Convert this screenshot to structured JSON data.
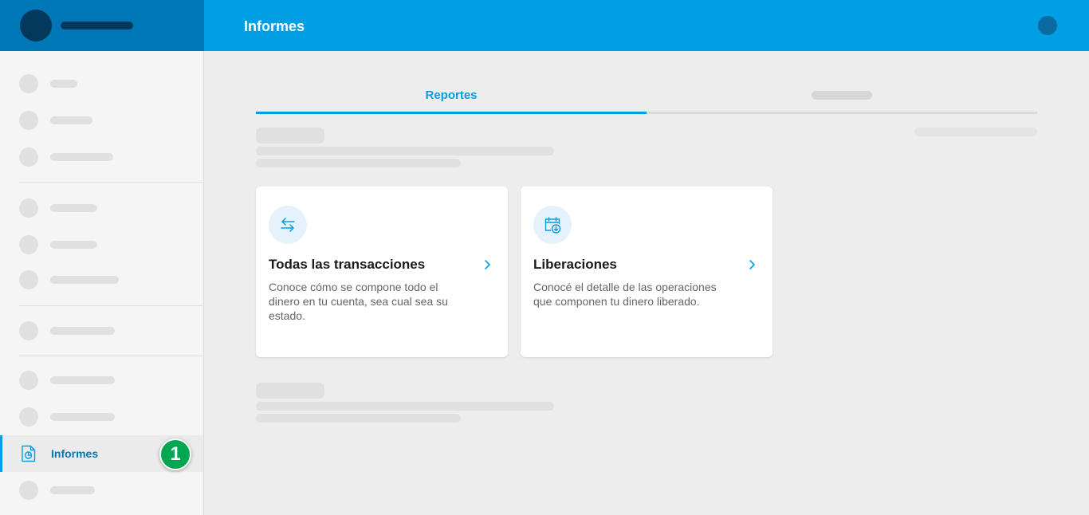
{
  "header": {
    "title": "Informes"
  },
  "sidebar": {
    "active_item": {
      "label": "Informes",
      "step_badge": "1"
    }
  },
  "tabs": [
    {
      "label": "Reportes",
      "active": true
    },
    {
      "label": "",
      "active": false
    }
  ],
  "cards": [
    {
      "icon": "arrows-swap-icon",
      "title": "Todas las transacciones",
      "description": "Conoce cómo se compone todo el dinero en tu cuenta, sea cual sea su estado."
    },
    {
      "icon": "calendar-download-icon",
      "title": "Liberaciones",
      "description": "Conocé el detalle de las operaciones que componen tu dinero liberado."
    }
  ],
  "colors": {
    "accent": "#009ee3",
    "header_dark": "#0078b7",
    "badge": "#00a650"
  }
}
